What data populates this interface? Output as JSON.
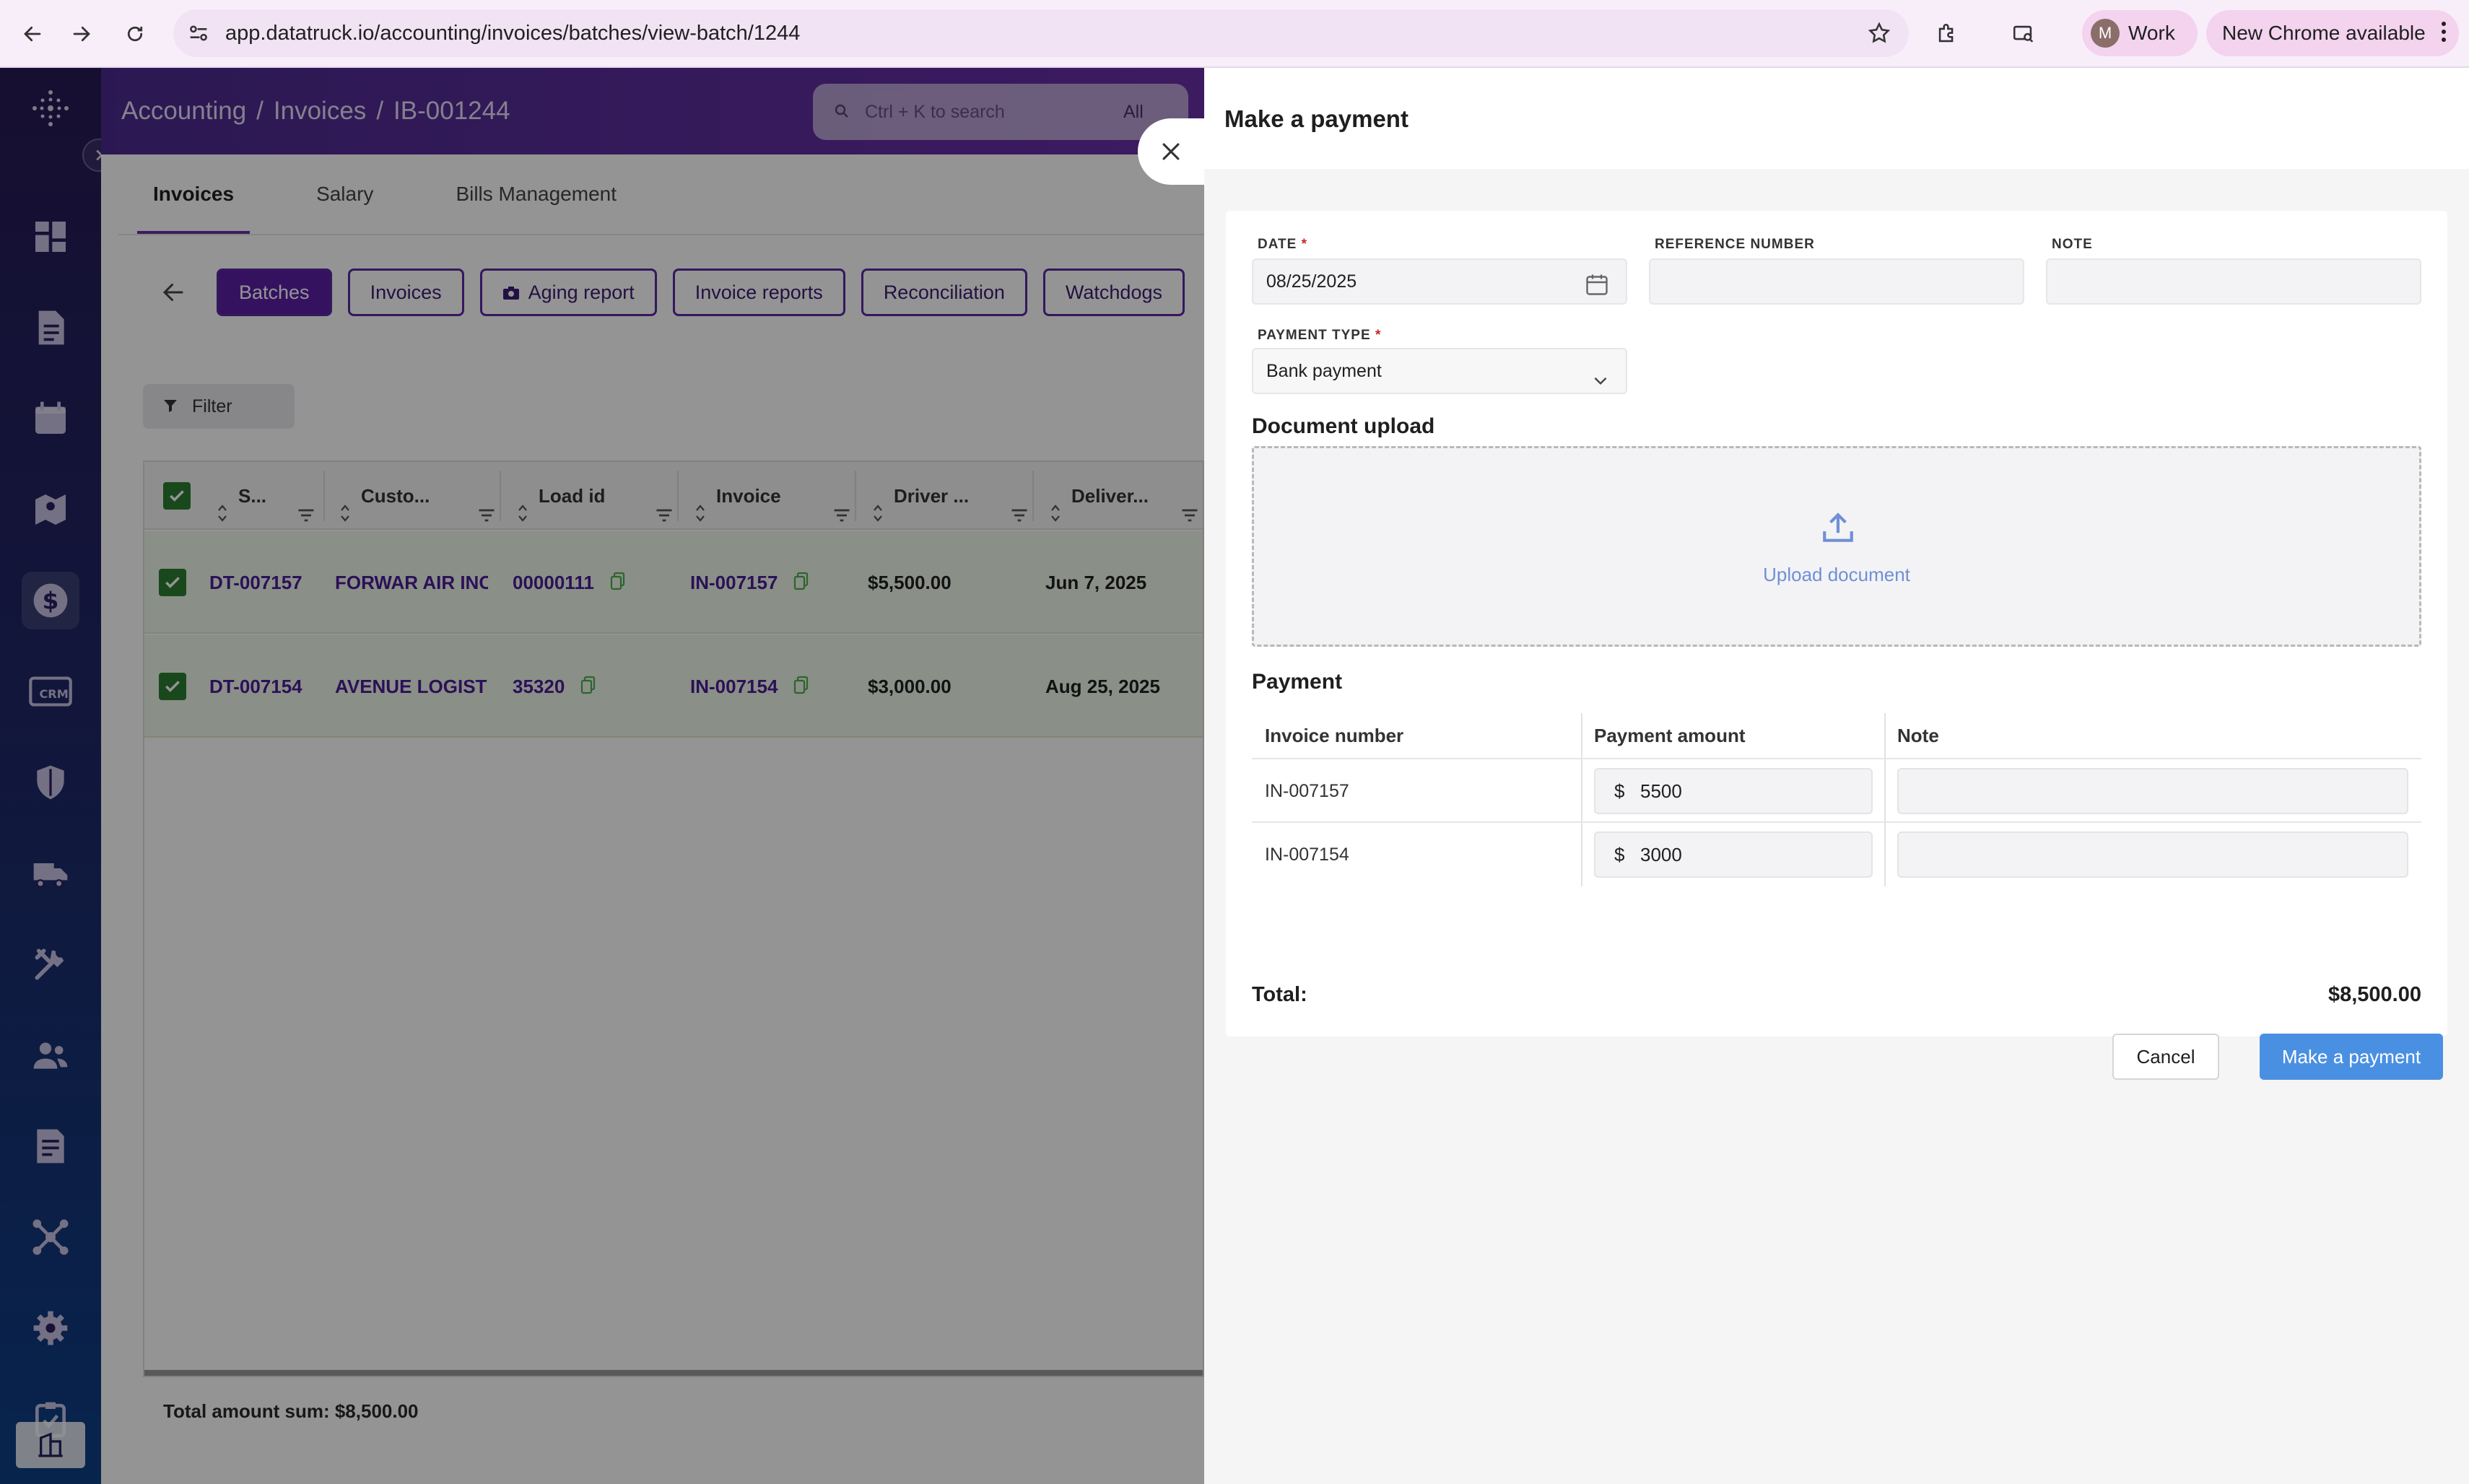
{
  "browser": {
    "url": "app.datatruck.io/accounting/invoices/batches/view-batch/1244",
    "profile_initial": "M",
    "profile_label": "Work",
    "update_label": "New Chrome available"
  },
  "header": {
    "breadcrumb": [
      "Accounting",
      "Invoices",
      "IB-001244"
    ],
    "search_placeholder": "Ctrl + K to search",
    "search_scope": "All"
  },
  "tabs": [
    "Invoices",
    "Salary",
    "Bills Management"
  ],
  "subnav": {
    "batches": "Batches",
    "invoices": "Invoices",
    "aging": "Aging report",
    "reports": "Invoice reports",
    "reconciliation": "Reconciliation",
    "watchdogs": "Watchdogs"
  },
  "filter_label": "Filter",
  "grid": {
    "columns": [
      "S...",
      "Custo...",
      "Load id",
      "Invoice",
      "Driver ...",
      "Deliver..."
    ],
    "rows": [
      {
        "s": "DT-007157",
        "customer": "FORWAR AIR INC",
        "load_id": "00000111",
        "invoice": "IN-007157",
        "driver": "$5,500.00",
        "delivery": "Jun 7, 2025"
      },
      {
        "s": "DT-007154",
        "customer": "AVENUE LOGISTICS",
        "load_id": "35320",
        "invoice": "IN-007154",
        "driver": "$3,000.00",
        "delivery": "Aug 25, 2025"
      }
    ],
    "total_sum": "Total amount sum: $8,500.00"
  },
  "drawer": {
    "title": "Make a payment",
    "date_label": "DATE",
    "date_value": "08/25/2025",
    "ref_label": "REFERENCE NUMBER",
    "ref_value": "",
    "note_label": "NOTE",
    "note_value": "",
    "payment_type_label": "PAYMENT TYPE",
    "payment_type_value": "Bank payment",
    "doc_upload_title": "Document upload",
    "upload_text": "Upload document",
    "payment_title": "Payment",
    "payment_columns": [
      "Invoice number",
      "Payment amount",
      "Note"
    ],
    "payments": [
      {
        "invoice": "IN-007157",
        "currency": "$",
        "amount": "5500",
        "note": ""
      },
      {
        "invoice": "IN-007154",
        "currency": "$",
        "amount": "3000",
        "note": ""
      }
    ],
    "total_label": "Total:",
    "total_value": "$8,500.00",
    "cancel_label": "Cancel",
    "submit_label": "Make a payment"
  },
  "colors": {
    "accent": "#5b1fa5",
    "primary_button": "#4a90e2",
    "row_selected": "#eef7e8",
    "checkbox": "#2e7d32"
  }
}
